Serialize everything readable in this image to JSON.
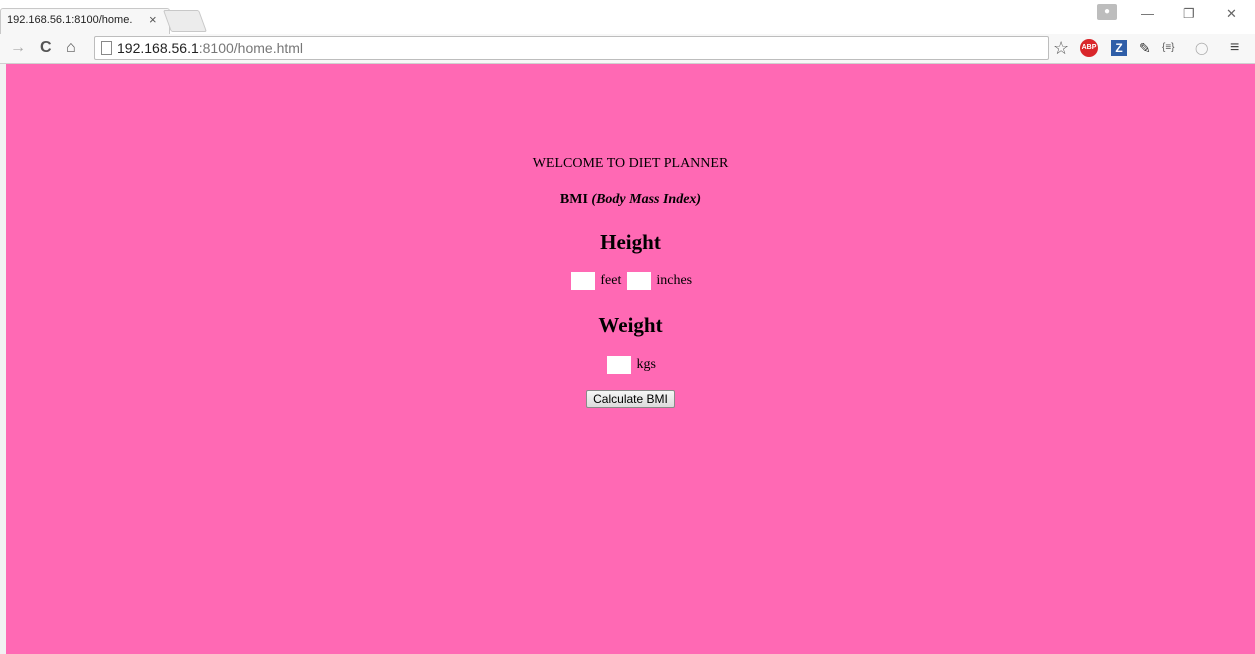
{
  "browser": {
    "tab_title": "192.168.56.1:8100/home.",
    "tab_close": "×",
    "url_host": "192.168.56.1",
    "url_rest": ":8100/home.html",
    "back_icon": "→",
    "reload_icon": "C",
    "home_icon": "⌂",
    "star_icon": "☆",
    "abp_label": "ABP",
    "zotero_label": "Z",
    "eyedropper_icon": "✎",
    "json_ext_label": "{≡}",
    "opera_icon": "◯",
    "menu_icon": "≡",
    "minimize_icon": "—",
    "restore_icon": "❐",
    "close_icon": "✕"
  },
  "page": {
    "background_color": "#ff69b4",
    "welcome": "WELCOME TO DIET PLANNER",
    "bmi_label": "BMI",
    "bmi_sub": "(Body Mass Index)",
    "height_heading": "Height",
    "feet_label": "feet",
    "inches_label": "inches",
    "weight_heading": "Weight",
    "kgs_label": "kgs",
    "calculate_button": "Calculate BMI",
    "feet_value": "",
    "inches_value": "",
    "kgs_value": ""
  }
}
